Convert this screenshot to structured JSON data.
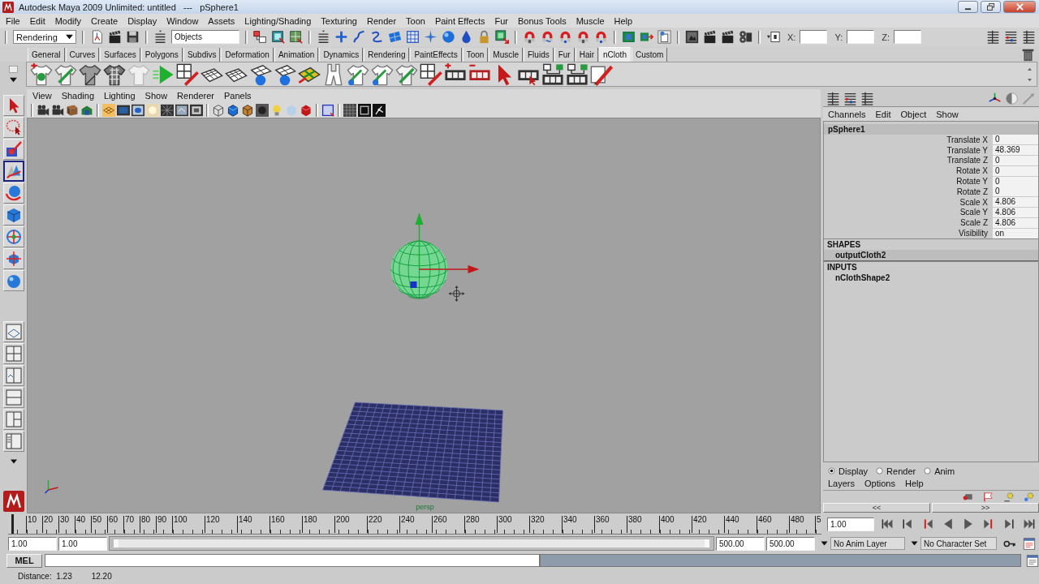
{
  "window": {
    "title": "Autodesk Maya 2009 Unlimited: untitled   ---   pSphere1"
  },
  "menu_bar": [
    "File",
    "Edit",
    "Modify",
    "Create",
    "Display",
    "Window",
    "Assets",
    "Lighting/Shading",
    "Texturing",
    "Render",
    "Toon",
    "Paint Effects",
    "Fur",
    "Bonus Tools",
    "Muscle",
    "Help"
  ],
  "status_line": {
    "menu_set": "Rendering",
    "selection_mask": "Objects",
    "coordinates": [
      {
        "label": "X:"
      },
      {
        "label": "Y:"
      },
      {
        "label": "Z:"
      }
    ]
  },
  "shelf": {
    "tabs": [
      {
        "label": "General",
        "selected": false
      },
      {
        "label": "Curves",
        "selected": false
      },
      {
        "label": "Surfaces",
        "selected": false
      },
      {
        "label": "Polygons",
        "selected": false
      },
      {
        "label": "Subdivs",
        "selected": false
      },
      {
        "label": "Deformation",
        "selected": false
      },
      {
        "label": "Animation",
        "selected": false
      },
      {
        "label": "Dynamics",
        "selected": false
      },
      {
        "label": "Rendering",
        "selected": false
      },
      {
        "label": "PaintEffects",
        "selected": false
      },
      {
        "label": "Toon",
        "selected": false
      },
      {
        "label": "Muscle",
        "selected": false
      },
      {
        "label": "Fluids",
        "selected": false
      },
      {
        "label": "Fur",
        "selected": false
      },
      {
        "label": "Hair",
        "selected": false
      },
      {
        "label": "nCloth",
        "selected": true
      },
      {
        "label": "Custom",
        "selected": false
      }
    ]
  },
  "toolbox": {
    "tools": [
      {
        "selected": false
      },
      {
        "selected": false
      },
      {
        "selected": false
      },
      {
        "selected": true
      },
      {
        "selected": false
      },
      {
        "selected": false
      },
      {
        "selected": false
      },
      {
        "selected": false
      },
      {
        "selected": false
      }
    ]
  },
  "viewport": {
    "menus": [
      "View",
      "Shading",
      "Lighting",
      "Show",
      "Renderer",
      "Panels"
    ],
    "camera": "persp"
  },
  "channel_box": {
    "menus": [
      "Channels",
      "Edit",
      "Object",
      "Show"
    ],
    "object": "pSphere1",
    "attributes": [
      {
        "name": "Translate X",
        "value": "0"
      },
      {
        "name": "Translate Y",
        "value": "48.369"
      },
      {
        "name": "Translate Z",
        "value": "0"
      },
      {
        "name": "Rotate X",
        "value": "0"
      },
      {
        "name": "Rotate Y",
        "value": "0"
      },
      {
        "name": "Rotate Z",
        "value": "0"
      },
      {
        "name": "Scale X",
        "value": "4.806"
      },
      {
        "name": "Scale Y",
        "value": "4.806"
      },
      {
        "name": "Scale Z",
        "value": "4.806"
      },
      {
        "name": "Visibility",
        "value": "on"
      }
    ],
    "shapes_heading": "SHAPES",
    "shapes": [
      {
        "name": "outputCloth2",
        "selected": true
      }
    ],
    "inputs_heading": "INPUTS",
    "inputs": [
      {
        "name": "nClothShape2",
        "selected": false
      }
    ]
  },
  "layer_editor": {
    "modes": [
      {
        "label": "Display",
        "selected": true
      },
      {
        "label": "Render",
        "selected": false
      },
      {
        "label": "Anim",
        "selected": false
      }
    ],
    "menus": [
      "Layers",
      "Options",
      "Help"
    ],
    "nav": [
      "<<",
      ">>"
    ]
  },
  "time_slider": {
    "frames": [
      "10",
      "20",
      "30",
      "40",
      "50",
      "60",
      "70",
      "80",
      "90",
      "100",
      "120",
      "140",
      "160",
      "180",
      "200",
      "220",
      "240",
      "260",
      "280",
      "300",
      "320",
      "340",
      "360",
      "380",
      "400",
      "420",
      "440",
      "460",
      "480",
      "5"
    ],
    "level": 0.002,
    "current_frame": "1.00"
  },
  "range_slider": {
    "start": "1.00",
    "playback_start": "1.00",
    "level": 1,
    "playback_end": "500.00",
    "end": "500.00",
    "anim_layer": "No Anim Layer",
    "character_set": "No Character Set"
  },
  "command_line": {
    "language": "MEL"
  },
  "help_line": [
    "Distance:  1.23",
    "12.20"
  ]
}
